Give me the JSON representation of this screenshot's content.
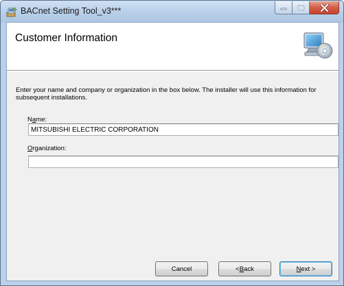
{
  "window": {
    "title": "BACnet Setting Tool_v3***"
  },
  "banner": {
    "title": "Customer Information",
    "art_icon": "computer-cd-icon"
  },
  "intro_text": "Enter your name and company or organization in the box below. The installer will use this information for subsequent installations.",
  "fields": {
    "name": {
      "label_pre": "N",
      "label_acc": "a",
      "label_post": "me:",
      "value": "MITSUBISHI ELECTRIC CORPORATION"
    },
    "organization": {
      "label_pre": "",
      "label_acc": "O",
      "label_post": "rganization:",
      "value": ""
    }
  },
  "buttons": {
    "cancel": {
      "pre": "Cancel",
      "acc": "",
      "post": ""
    },
    "back": {
      "pre": "< ",
      "acc": "B",
      "post": "ack"
    },
    "next": {
      "pre": "",
      "acc": "N",
      "post": "ext >"
    }
  },
  "colors": {
    "close_button": "#c8412c",
    "default_button_border": "#3c7fb1"
  }
}
